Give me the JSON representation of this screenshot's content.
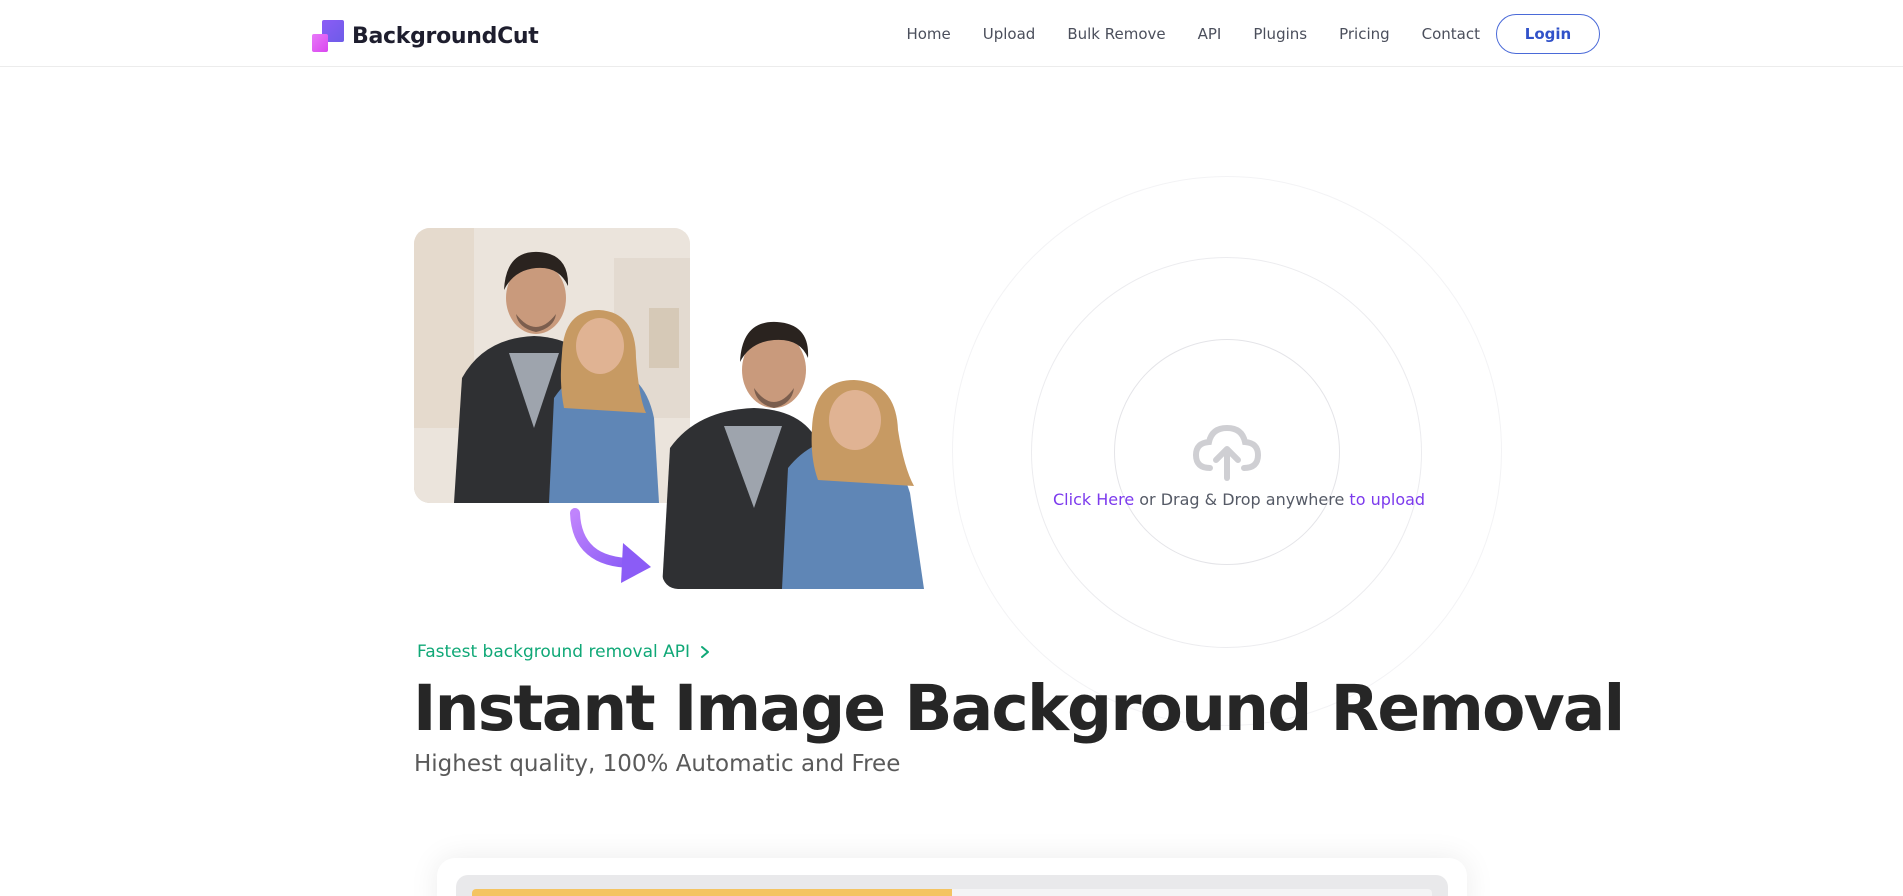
{
  "brand": {
    "name": "BackgroundCut"
  },
  "nav": {
    "links": [
      "Home",
      "Upload",
      "Bulk Remove",
      "API",
      "Plugins",
      "Pricing",
      "Contact"
    ],
    "login_label": "Login"
  },
  "upload": {
    "click_here": "Click Here",
    "middle": " or Drag & Drop anywhere ",
    "to_upload": "to upload"
  },
  "hero": {
    "api_link": "Fastest background removal API",
    "title": "Instant Image Background Removal",
    "subtitle": "Highest quality, 100% Automatic and Free"
  },
  "demo_bar": {
    "progress": 0.5
  },
  "colors": {
    "accent_purple": "#7c3aed",
    "accent_green": "#10a877",
    "login_border": "#4a6ad8"
  },
  "icons": {
    "upload": "cloud-upload-icon",
    "arrow": "curved-arrow-icon",
    "chevron": "chevron-right-icon"
  }
}
